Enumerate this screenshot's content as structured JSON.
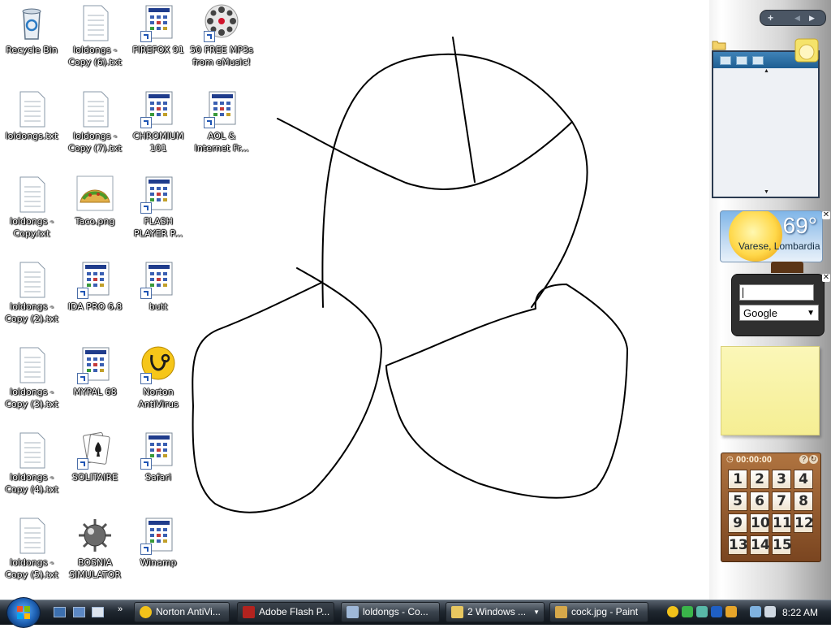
{
  "desktop": {
    "icons": [
      {
        "label": "Recycle Bin",
        "kind": "recycle-bin"
      },
      {
        "label": "loldongs.txt",
        "kind": "text-file"
      },
      {
        "label": "loldongs - Copy.txt",
        "kind": "text-file"
      },
      {
        "label": "loldongs - Copy (2).txt",
        "kind": "text-file"
      },
      {
        "label": "loldongs - Copy (3).txt",
        "kind": "text-file"
      },
      {
        "label": "loldongs - Copy (4).txt",
        "kind": "text-file"
      },
      {
        "label": "loldongs - Copy (5).txt",
        "kind": "text-file"
      },
      {
        "label": "loldongs - Copy (6).txt",
        "kind": "text-file"
      },
      {
        "label": "loldongs - Copy (7).txt",
        "kind": "text-file"
      },
      {
        "label": "Taco.png",
        "kind": "image-file"
      },
      {
        "label": "IDA PRO 6.8",
        "kind": "app-shortcut"
      },
      {
        "label": "MYPAL 68",
        "kind": "app-shortcut"
      },
      {
        "label": "SOLITAIRE",
        "kind": "solitaire-shortcut"
      },
      {
        "label": "BOSNIA SIMULATOR",
        "kind": "mine-icon"
      },
      {
        "label": "FIREFOX 91",
        "kind": "app-shortcut"
      },
      {
        "label": "CHROMIUM 101",
        "kind": "app-shortcut"
      },
      {
        "label": "FLASH PLAYER P...",
        "kind": "app-shortcut"
      },
      {
        "label": "butt",
        "kind": "app-shortcut"
      },
      {
        "label": "Norton AntiVirus",
        "kind": "norton-shortcut"
      },
      {
        "label": "Safari",
        "kind": "app-shortcut"
      },
      {
        "label": "Winamp",
        "kind": "app-shortcut"
      },
      {
        "label": "50 FREE MP3s from eMusic!",
        "kind": "music-shortcut"
      },
      {
        "label": "AOL & Internet Fr...",
        "kind": "app-shortcut"
      }
    ]
  },
  "sidebar": {
    "controls": {
      "add": "+",
      "prev": "◀",
      "next": "▶"
    },
    "weather": {
      "temperature": "69°",
      "location": "Varese, Lombardia"
    },
    "search": {
      "input_value": "",
      "engine": "Google"
    },
    "slide_puzzle": {
      "timer": "00:00:00",
      "tiles": [
        "1",
        "2",
        "3",
        "4",
        "5",
        "6",
        "7",
        "8",
        "9",
        "10",
        "11",
        "12",
        "13",
        "14",
        "15"
      ]
    }
  },
  "taskbar": {
    "tasks": [
      {
        "label": "Norton AntiVi...",
        "icon_color": "#f2c21a"
      },
      {
        "label": "Adobe Flash P...",
        "icon_color": "#b3231f"
      },
      {
        "label": "loldongs - Co...",
        "icon_color": "#9fb8d8"
      },
      {
        "label": "2 Windows ...",
        "icon_color": "#e8c760"
      },
      {
        "label": "cock.jpg - Paint",
        "icon_color": "#d6a84a"
      }
    ],
    "clock": "8:22 AM"
  },
  "colors": {
    "taskbar": "#1f2730",
    "desktop": "#ffffff",
    "sticky_note": "#f5ee93"
  }
}
